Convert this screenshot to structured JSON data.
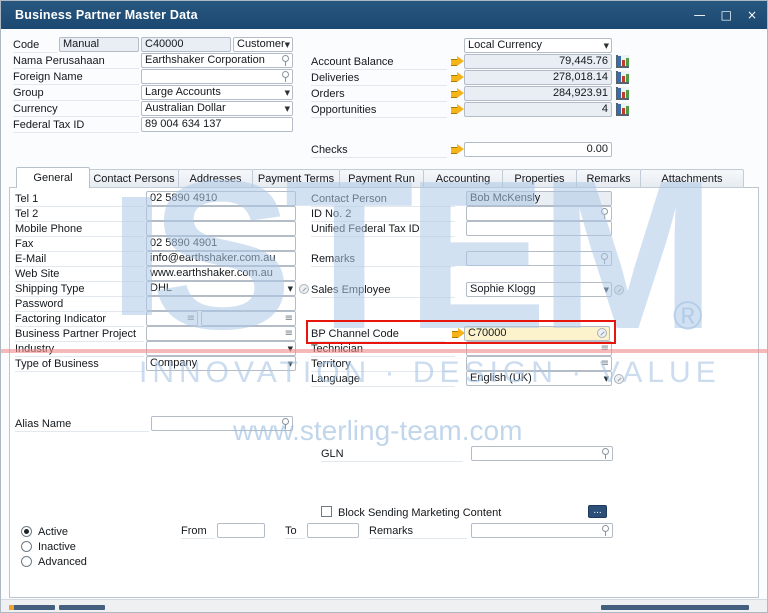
{
  "titlebar": {
    "title": "Business Partner Master Data"
  },
  "icons": {
    "minimize": "—",
    "maximize": "□",
    "close": "×",
    "dropdown": "▼",
    "choose_from_list": "≡",
    "more": "..."
  },
  "header": {
    "code": {
      "label": "Code",
      "mode": "Manual",
      "value": "C40000",
      "type": "Customer"
    },
    "left": [
      {
        "label": "Nama Perusahaan",
        "value": "Earthshaker Corporation"
      },
      {
        "label": "Foreign Name",
        "value": ""
      },
      {
        "label": "Group",
        "value": "Large Accounts"
      },
      {
        "label": "Currency",
        "value": "Australian Dollar"
      },
      {
        "label": "Federal Tax ID",
        "value": "89 004 634 137"
      }
    ],
    "currency_selector": "Local Currency",
    "kpis": [
      {
        "label": "Account Balance",
        "value": "79,445.76"
      },
      {
        "label": "Deliveries",
        "value": "278,018.14"
      },
      {
        "label": "Orders",
        "value": "284,923.91"
      },
      {
        "label": "Opportunities",
        "value": "4"
      }
    ],
    "checks": {
      "label": "Checks",
      "value": "0.00"
    }
  },
  "tabs": [
    "General",
    "Contact Persons",
    "Addresses",
    "Payment Terms",
    "Payment Run",
    "Accounting",
    "Properties",
    "Remarks",
    "Attachments"
  ],
  "general": {
    "left": [
      {
        "label": "Tel 1",
        "value": "02 5890 4910"
      },
      {
        "label": "Tel 2",
        "value": ""
      },
      {
        "label": "Mobile Phone",
        "value": ""
      },
      {
        "label": "Fax",
        "value": "02 5890 4901"
      },
      {
        "label": "E-Mail",
        "value": "info@earthshaker.com.au"
      },
      {
        "label": "Web Site",
        "value": "www.earthshaker.com.au"
      },
      {
        "label": "Shipping Type",
        "value": "DHL"
      },
      {
        "label": "Password",
        "value": ""
      },
      {
        "label": "Factoring Indicator",
        "value": "",
        "value2": ""
      },
      {
        "label": "Business Partner Project",
        "value": ""
      },
      {
        "label": "Industry",
        "value": ""
      },
      {
        "label": "Type of Business",
        "value": "Company"
      }
    ],
    "right": [
      {
        "label": "Contact Person",
        "value": "Bob McKensly"
      },
      {
        "label": "ID No. 2",
        "value": ""
      },
      {
        "label": "Unified Federal Tax ID",
        "value": ""
      },
      {
        "label": "Remarks",
        "value": ""
      },
      {
        "label": "Sales Employee",
        "value": "Sophie Klogg"
      },
      {
        "label": "BP Channel Code",
        "value": "C70000"
      },
      {
        "label": "Technician",
        "value": ""
      },
      {
        "label": "Territory",
        "value": ""
      },
      {
        "label": "Language",
        "value": "English (UK)"
      }
    ],
    "alias": {
      "label": "Alias Name",
      "value": ""
    },
    "gln": {
      "label": "GLN",
      "value": ""
    },
    "marketing": {
      "label": "Block Sending Marketing Content",
      "checked": false,
      "from": "From",
      "from_value": "",
      "to": "To",
      "to_value": "",
      "remarks": "Remarks",
      "remarks_value": ""
    },
    "status": {
      "options": [
        "Active",
        "Inactive",
        "Advanced"
      ],
      "selected": "Active"
    }
  },
  "watermark": {
    "logo": "STEM",
    "registered": "®",
    "tagline": "INNOVATION · DESIGN · VALUE",
    "website": "www.sterling-team.com"
  },
  "colors": {
    "titlebar": "#1c4871",
    "highlight_red": "#e8150d",
    "gold_arrow": "#f5b519",
    "watermark_blue": "#adc8e6",
    "readonly_bg": "#e9eef4",
    "focus_bg": "#fcf3cd"
  }
}
